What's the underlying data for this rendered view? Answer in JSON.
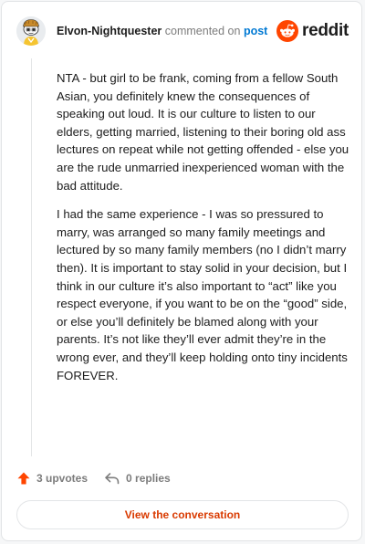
{
  "comment": {
    "username": "Elvon-Nightquester",
    "commented_on": "commented on",
    "post_link": "post",
    "paragraphs": [
      "NTA - but girl to be frank, coming from a fellow South Asian, you definitely knew the consequences of speaking out loud. It is our culture to listen to our elders, getting married, listening to their boring old ass lectures on repeat while not getting offended - else you are the rude unmarried inexperienced woman with the bad attitude.",
      "I had the same experience - I was so pressured to marry, was arranged so many family meetings and lectured by so many family members (no I didn’t marry then). It is important to stay solid in your decision, but I think in our culture it’s also important to “act” like you respect everyone, if you want to be on the “good” side, or else you’ll definitely be blamed along with your parents. It’s not like they’ll ever admit they’re in the wrong ever, and they’ll keep holding onto tiny incidents FOREVER."
    ]
  },
  "logo": {
    "text": "reddit",
    "brand_color": "#ff4500"
  },
  "actions": {
    "upvotes": "3 upvotes",
    "replies": "0 replies",
    "upvote_color": "#ff4500"
  },
  "view_button": {
    "label": "View the conversation",
    "color": "#d93a00"
  },
  "icons": {
    "avatar": "snoo-avatar",
    "logo": "reddit-alien-icon",
    "upvote": "upvote-arrow-icon",
    "reply": "reply-arrow-icon"
  }
}
